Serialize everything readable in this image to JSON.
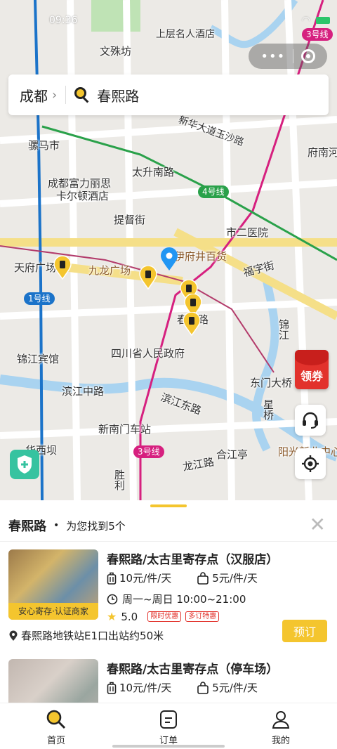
{
  "status_bar": {
    "time": "09:36"
  },
  "map": {
    "labels": {
      "wenshufang": "文殊坊",
      "shangceng": "上层名人酒店",
      "luomashi": "骡马市",
      "fuli": "成都富力丽思",
      "kaerdun": "卡尔顿酒店",
      "taishengnanlu": "太升南路",
      "xinhuadadao": "新华大道玉沙路",
      "tidujie": "提督街",
      "shiersyiyuan": "市二医院",
      "fuzijie": "福字街",
      "tianfuguangchang": "天府广场",
      "jiulongguangchang": "九龙广场",
      "yijingbaihuo": "伊府井百货",
      "chunxilu_map": "春熙路",
      "sichuanzhengfu": "四川省人民政府",
      "jinjiangbinguan": "锦江宾馆",
      "binjiangzhonglu": "滨江中路",
      "binjiangdonglu": "滨江东路",
      "xinnanmen": "新南门车站",
      "dongmendaqiao": "东门大桥",
      "huaxiba": "华西坝",
      "hejiangting": "合江亭",
      "longjianglu": "龙江路",
      "yangguang": "阳光新业中心",
      "jinjiang": "锦江",
      "funanhe": "府南河",
      "shenglilu": "胜利",
      "xingqiao": "星桥",
      "line1": "1号线",
      "line3a": "3号线",
      "line3b": "3号线",
      "line4": "4号线"
    }
  },
  "search": {
    "city": "成都",
    "query": "春熙路"
  },
  "coupon": {
    "label": "领券"
  },
  "sheet": {
    "query": "春熙路",
    "found_text": "为您找到5个",
    "results": [
      {
        "title": "春熙路/太古里寄存点（汉服店）",
        "tag": "安心寄存·认证商家",
        "price_box": "10元/件/天",
        "price_bag": "5元/件/天",
        "hours": "周一~周日 10:00~21:00",
        "rating": "5.0",
        "badges": [
          "限时优惠",
          "多订特惠"
        ],
        "location": "春熙路地铁站E1口出站约50米",
        "book_label": "预订"
      },
      {
        "title": "春熙路/太古里寄存点（停车场）",
        "price_box": "10元/件/天",
        "price_bag": "5元/件/天"
      }
    ]
  },
  "tabs": [
    {
      "label": "首页",
      "icon": "search-icon"
    },
    {
      "label": "订单",
      "icon": "order-icon"
    },
    {
      "label": "我的",
      "icon": "profile-icon"
    }
  ],
  "colors": {
    "accent": "#f4c52e",
    "red": "#e2322c",
    "line1": "#1b73c9",
    "line3": "#d6207f",
    "line4": "#2aa14a"
  }
}
